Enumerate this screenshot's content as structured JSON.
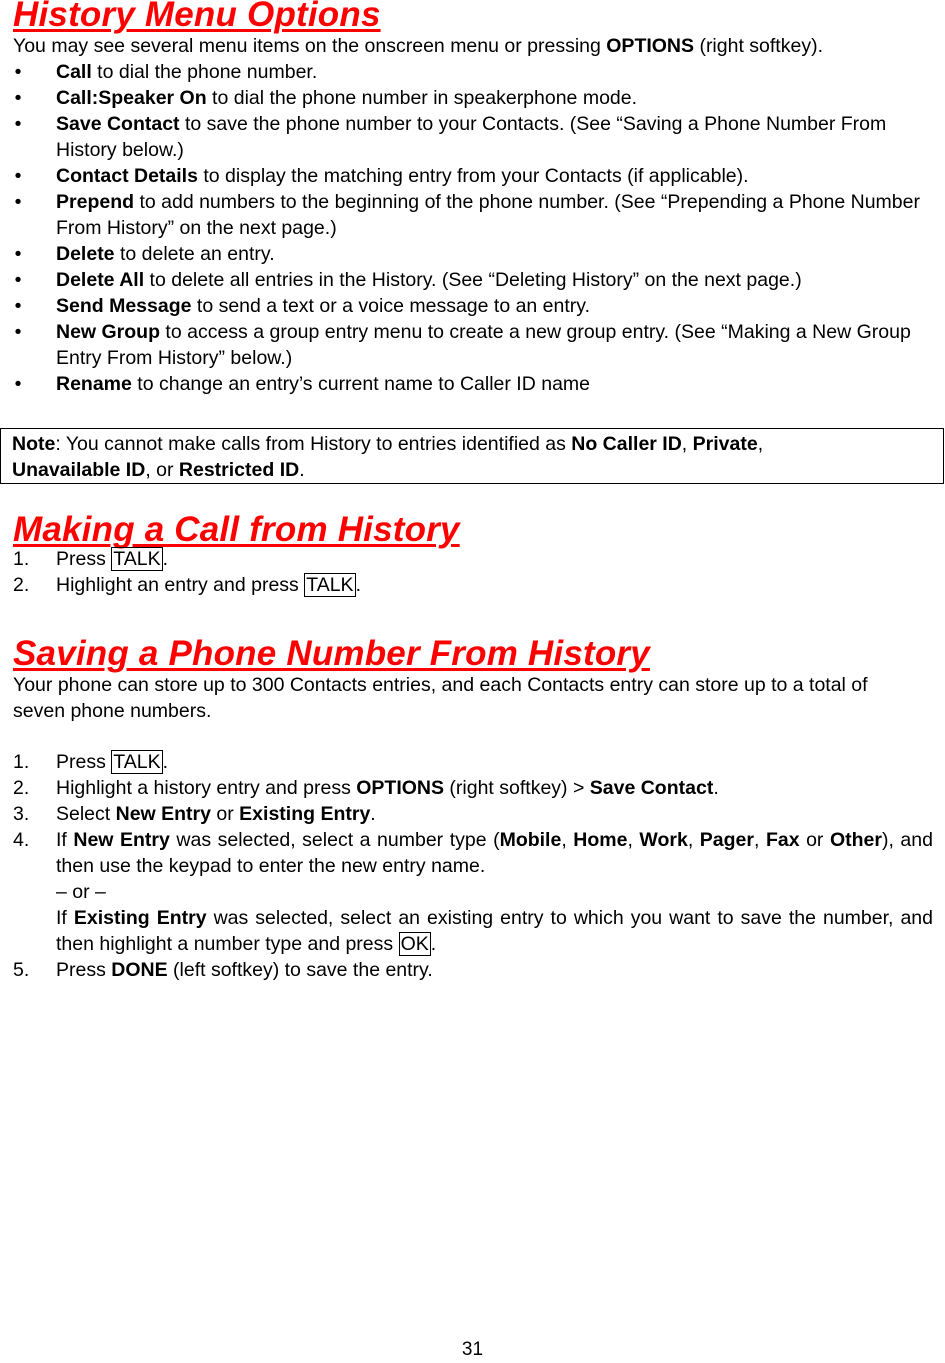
{
  "history_menu": {
    "title": "History Menu Options",
    "intro_pre": "You may see several menu items on the onscreen menu or pressing ",
    "intro_bold": "OPTIONS",
    "intro_post": " (right softkey).",
    "items": [
      {
        "bold": "Call",
        "text": " to dial the phone number."
      },
      {
        "bold": "Call:Speaker On",
        "text": " to dial the phone number in speakerphone mode."
      },
      {
        "bold": "Save Contact",
        "text": " to save the phone number to your Contacts. (See “Saving a Phone Number From History below.)"
      },
      {
        "bold": "Contact Details",
        "text": " to display the matching entry from your Contacts (if applicable)."
      },
      {
        "bold": "Prepend",
        "text": " to add numbers to the beginning of the phone number. (See “Prepending a Phone Number From History” on the next page.)"
      },
      {
        "bold": "Delete",
        "text": " to delete an entry."
      },
      {
        "bold": "Delete All",
        "text": " to delete all entries in the History. (See “Deleting History” on the next page.)"
      },
      {
        "bold": "Send Message",
        "text": " to send a text or a voice message to an entry."
      },
      {
        "bold": "New Group",
        "text": " to access a group entry menu to create a new group entry. (See “Making a New Group Entry From History” below.)"
      },
      {
        "bold": "Rename",
        "text": " to change an entry’s current name to Caller ID name"
      }
    ],
    "bullet": "•"
  },
  "note": {
    "label": "Note",
    "t1": ": You cannot make calls from History to entries identified as ",
    "b1": "No Caller ID",
    "t2": ", ",
    "b2": "Private",
    "t3": ", ",
    "b3": "Unavailable ID",
    "t4": ", or ",
    "b4": "Restricted ID",
    "t5": "."
  },
  "making_call": {
    "title": "Making a Call from History",
    "steps": [
      {
        "num": "1.",
        "pre": "Press ",
        "key": "TALK",
        "post": "."
      },
      {
        "num": "2.",
        "pre": "Highlight an entry and press ",
        "key": "TALK",
        "post": "."
      }
    ]
  },
  "saving": {
    "title": "Saving a Phone Number From History",
    "intro": "Your phone can store up to 300 Contacts entries, and each Contacts entry can store up to a total of seven phone numbers.",
    "step1": {
      "num": "1.",
      "pre": "Press ",
      "key": "TALK",
      "post": "."
    },
    "step2": {
      "num": "2.",
      "pre": "Highlight a history entry and press ",
      "b1": "OPTIONS",
      "mid": " (right softkey) > ",
      "b2": "Save Contact",
      "post": "."
    },
    "step3": {
      "num": "3.",
      "pre": "Select ",
      "b1": "New Entry",
      "mid": " or ",
      "b2": "Existing Entry",
      "post": "."
    },
    "step4": {
      "num": "4.",
      "a_pre": "If ",
      "a_b1": "New Entry",
      "a_t1": " was selected, select a number type (",
      "a_b2": "Mobile",
      "a_t2": ", ",
      "a_b3": "Home",
      "a_t3": ", ",
      "a_b4": "Work",
      "a_t4": ", ",
      "a_b5": "Pager",
      "a_t5": ", ",
      "a_b6": "Fax",
      "a_t6": " or ",
      "a_b7": "Other",
      "a_t7": "), and then use the keypad to enter the new entry name.",
      "or": "– or –",
      "b_pre": "If ",
      "b_b1": "Existing Entry",
      "b_t1": " was selected, select an existing entry to which you want to save the number, and then highlight a number type and press ",
      "b_key": "OK",
      "b_post": "."
    },
    "step5": {
      "num": "5.",
      "pre": "Press ",
      "b1": "DONE",
      "post": " (left softkey) to save the entry."
    }
  },
  "page_number": "31"
}
